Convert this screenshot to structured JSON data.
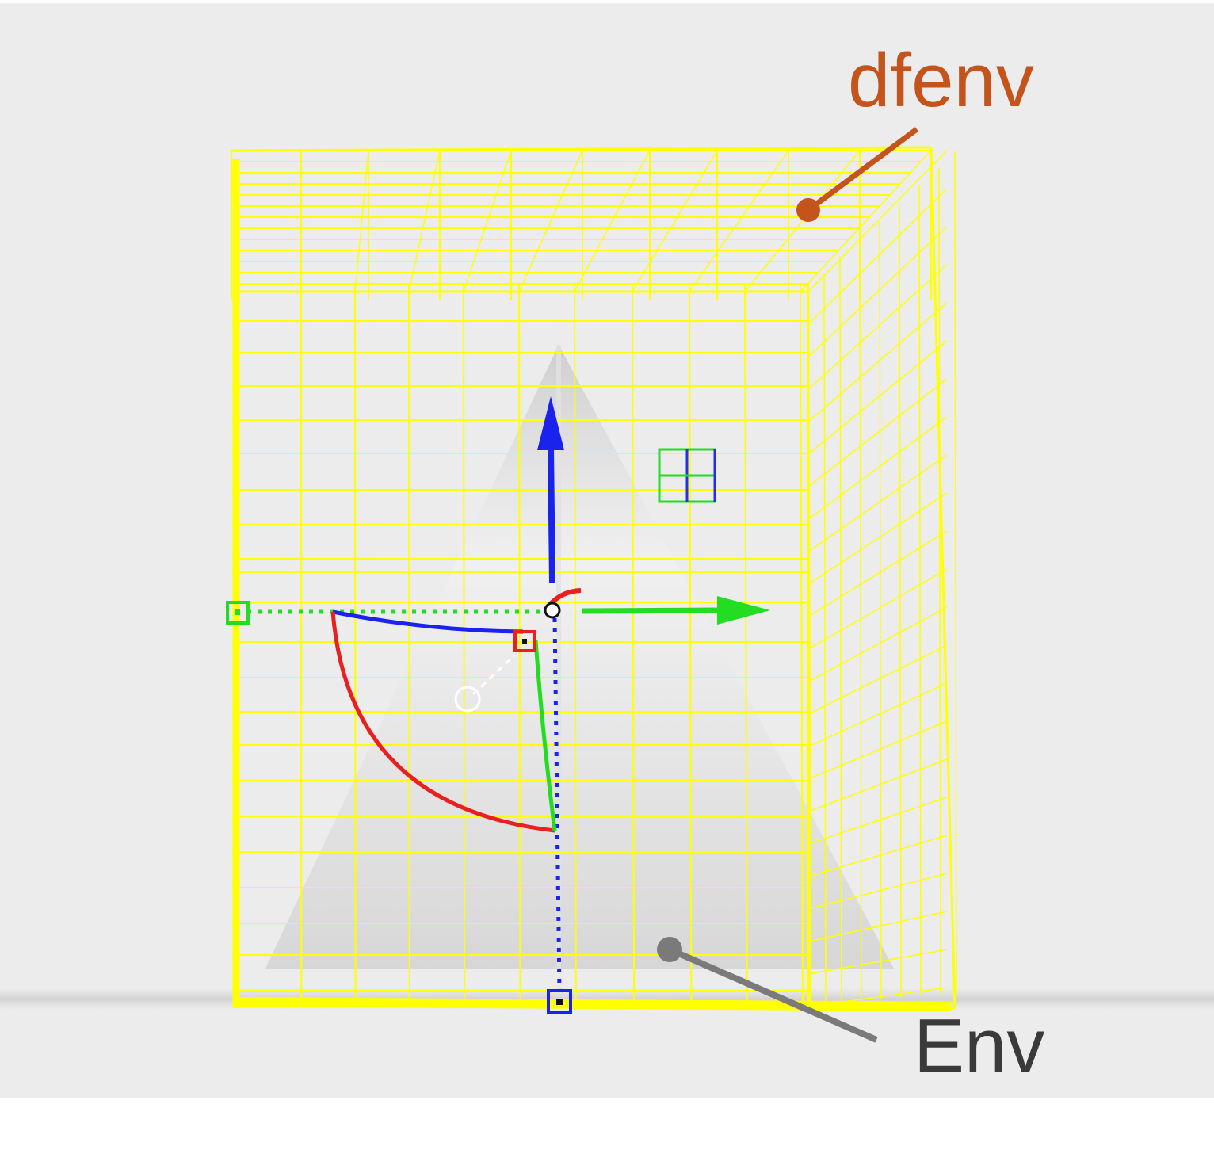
{
  "colors": {
    "background": "#ececec",
    "lattice": "#ffff00",
    "callout_dfenv": "#c4541c",
    "callout_env": "#7a7a7a",
    "label_env": "#3a3a3a",
    "axis_z": "#1a22ee",
    "axis_y": "#22dd22",
    "axis_x": "#e82020",
    "cone": "#cfcfcf"
  },
  "callouts": {
    "dfenv": {
      "label": "dfenv",
      "target": "deformer-lattice"
    },
    "env": {
      "label": "Env",
      "target": "environment-object"
    }
  },
  "manipulator": {
    "axes": [
      "z",
      "y",
      "x"
    ],
    "handles": [
      "pivot",
      "scale-handle",
      "rotate-handle",
      "translate-handle-y",
      "translate-handle-z"
    ]
  },
  "icons": [
    "grid-icon",
    "pivot-icon"
  ]
}
